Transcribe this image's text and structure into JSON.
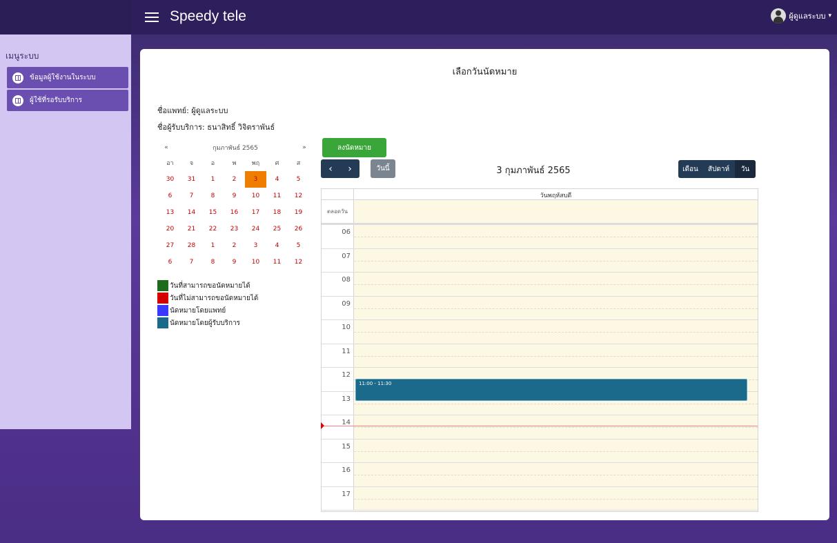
{
  "header": {
    "brand": "Speedy tele",
    "user_name": "ผู้ดูแลระบบ"
  },
  "sidebar": {
    "title": "เมนูระบบ",
    "items": [
      {
        "label": "ข้อมูลผู้ใช้งานในระบบ",
        "icon": "book-icon"
      },
      {
        "label": "ผู้ใช้ที่รอรับบริการ",
        "icon": "book-icon"
      }
    ]
  },
  "main": {
    "title": "เลือกวันนัดหมาย",
    "doctor": "ชื่อแพทย์: ผู้ดูแลระบบ",
    "patient": "ชื่อผู้รับบริการ: ธนาสิทธิ์ วิจิตราพันธ์"
  },
  "mini_calendar": {
    "prev": "«",
    "next": "»",
    "month_label": "กุมภาพันธ์ 2565",
    "weekdays": [
      "อา",
      "จ",
      "อ",
      "พ",
      "พฤ",
      "ศ",
      "ส"
    ],
    "weeks": [
      [
        "30",
        "31",
        "1",
        "2",
        "3",
        "4",
        "5"
      ],
      [
        "6",
        "7",
        "8",
        "9",
        "10",
        "11",
        "12"
      ],
      [
        "13",
        "14",
        "15",
        "16",
        "17",
        "18",
        "19"
      ],
      [
        "20",
        "21",
        "22",
        "23",
        "24",
        "25",
        "26"
      ],
      [
        "27",
        "28",
        "1",
        "2",
        "3",
        "4",
        "5"
      ],
      [
        "6",
        "7",
        "8",
        "9",
        "10",
        "11",
        "12"
      ]
    ],
    "selected": "3"
  },
  "legend": [
    {
      "label": "วันที่สามารถขอนัดหมายได้",
      "color": "#1e6b1e"
    },
    {
      "label": "วันที่ไม่สามารถขอนัดหมายได้",
      "color": "#d40000"
    },
    {
      "label": "นัดหมายโดยแพทย์",
      "color": "#3a3aff"
    },
    {
      "label": "นัดหมายโดยผู้รับบริการ",
      "color": "#1b6a8c"
    }
  ],
  "toolbar": {
    "add_label": "ลงนัดหมาย",
    "prev": "‹",
    "next": "›",
    "today": "วันนี้",
    "title": "3 กุมภาพันธ์ 2565",
    "views": [
      "เดือน",
      "สัปดาห์",
      "วัน"
    ],
    "active_view": "วัน"
  },
  "day_view": {
    "day_label": "วันพฤหัสบดี",
    "allday_label": "ตลอดวัน",
    "hours": [
      "06",
      "07",
      "08",
      "09",
      "10",
      "11",
      "12",
      "13",
      "14",
      "15",
      "16",
      "17"
    ],
    "event": {
      "time": "11:00 - 11:30",
      "color": "#1b6a8c"
    }
  },
  "colors": {
    "accent": "#6a4fb0",
    "selected_day": "#ef7d00",
    "add_button": "#3aa63a"
  }
}
